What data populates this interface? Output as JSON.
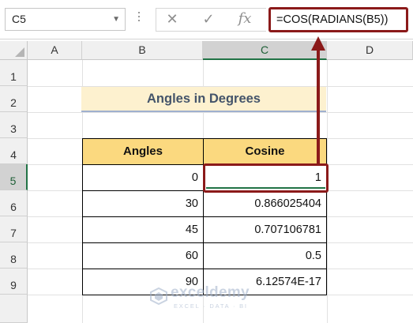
{
  "name_box": {
    "value": "C5"
  },
  "formula_bar": {
    "cancel_glyph": "✕",
    "enter_glyph": "✓",
    "fx_label": "fx",
    "formula": "=COS(RADIANS(B5))"
  },
  "columns": [
    "A",
    "B",
    "C",
    "D"
  ],
  "rows": [
    "1",
    "2",
    "3",
    "4",
    "5",
    "6",
    "7",
    "8",
    "9"
  ],
  "selected": {
    "column": "C",
    "row": "5"
  },
  "title": "Angles in Degrees",
  "table": {
    "headers": [
      "Angles",
      "Cosine"
    ],
    "rows": [
      {
        "angle": "0",
        "cosine": "1"
      },
      {
        "angle": "30",
        "cosine": "0.866025404"
      },
      {
        "angle": "45",
        "cosine": "0.707106781"
      },
      {
        "angle": "60",
        "cosine": "0.5"
      },
      {
        "angle": "90",
        "cosine": "6.12574E-17"
      }
    ]
  },
  "watermark": {
    "name": "exceldemy",
    "tagline": "EXCEL · DATA · BI"
  },
  "colors": {
    "highlight": "#8b1a1a",
    "header_fill": "#fbd97f",
    "title_fill": "#fdf1cf",
    "excel_green": "#217346"
  }
}
